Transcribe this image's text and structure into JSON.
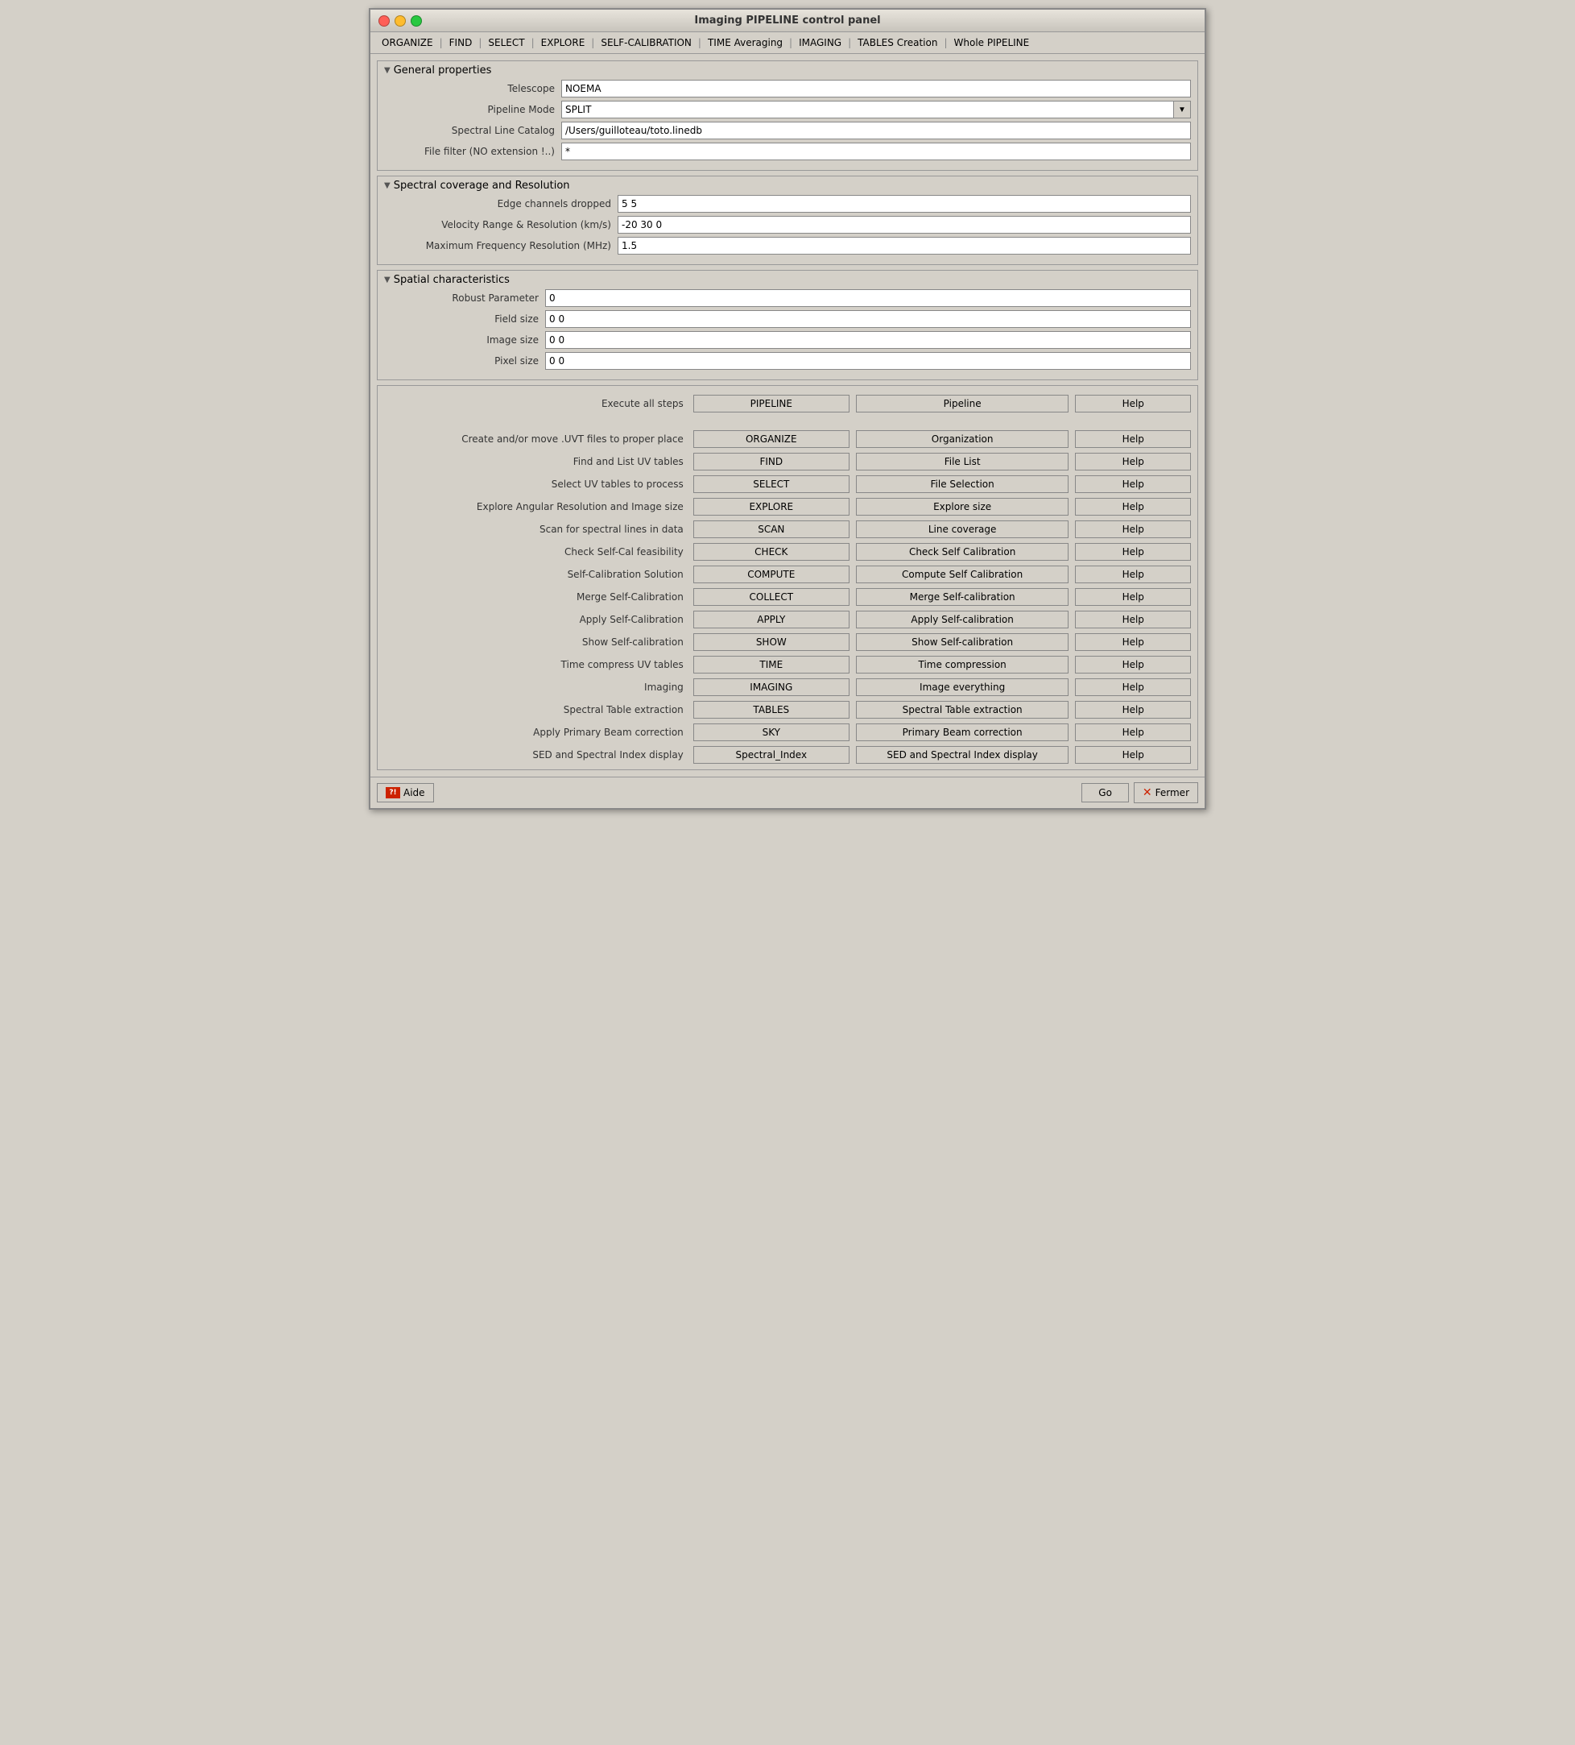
{
  "window": {
    "title": "Imaging PIPELINE control panel"
  },
  "menubar": {
    "items": [
      {
        "label": "ORGANIZE"
      },
      {
        "label": "FIND"
      },
      {
        "label": "SELECT"
      },
      {
        "label": "EXPLORE"
      },
      {
        "label": "SELF-CALIBRATION"
      },
      {
        "label": "TIME Averaging"
      },
      {
        "label": "IMAGING"
      },
      {
        "label": "TABLES Creation"
      },
      {
        "label": "Whole PIPELINE"
      }
    ]
  },
  "general": {
    "title": "General properties",
    "fields": {
      "telescope_label": "Telescope",
      "telescope_value": "NOEMA",
      "pipeline_mode_label": "Pipeline Mode",
      "pipeline_mode_value": "SPLIT",
      "spectral_catalog_label": "Spectral Line Catalog",
      "spectral_catalog_value": "/Users/guilloteau/toto.linedb",
      "file_filter_label": "File filter (NO extension !..)",
      "file_filter_value": "*"
    }
  },
  "spectral": {
    "title": "Spectral coverage and Resolution",
    "fields": {
      "edge_channels_label": "Edge channels dropped",
      "edge_channels_value": "5 5",
      "velocity_label": "Velocity Range & Resolution (km/s)",
      "velocity_value": "-20 30 0",
      "max_freq_label": "Maximum Frequency Resolution (MHz)",
      "max_freq_value": "1.5"
    }
  },
  "spatial": {
    "title": "Spatial characteristics",
    "fields": {
      "robust_label": "Robust Parameter",
      "robust_value": "0",
      "field_size_label": "Field  size",
      "field_size_value": "0 0",
      "image_size_label": "Image size",
      "image_size_value": "0 0",
      "pixel_size_label": "Pixel size",
      "pixel_size_value": "0 0"
    }
  },
  "actions": {
    "execute_all_label": "Execute all steps",
    "pipeline_btn": "PIPELINE",
    "pipeline_doc_btn": "Pipeline",
    "help_btn": "Help",
    "rows": [
      {
        "label": "Create and/or move .UVT files to proper place",
        "action": "ORGANIZE",
        "doc": "Organization",
        "help": "Help"
      },
      {
        "label": "Find and List UV tables",
        "action": "FIND",
        "doc": "File List",
        "help": "Help"
      },
      {
        "label": "Select UV tables to process",
        "action": "SELECT",
        "doc": "File Selection",
        "help": "Help"
      },
      {
        "label": "Explore Angular Resolution and Image size",
        "action": "EXPLORE",
        "doc": "Explore size",
        "help": "Help"
      },
      {
        "label": "Scan for spectral lines in data",
        "action": "SCAN",
        "doc": "Line coverage",
        "help": "Help"
      },
      {
        "label": "Check Self-Cal feasibility",
        "action": "CHECK",
        "doc": "Check Self Calibration",
        "help": "Help"
      },
      {
        "label": "Self-Calibration Solution",
        "action": "COMPUTE",
        "doc": "Compute Self Calibration",
        "help": "Help"
      },
      {
        "label": "Merge Self-Calibration",
        "action": "COLLECT",
        "doc": "Merge Self-calibration",
        "help": "Help"
      },
      {
        "label": "Apply Self-Calibration",
        "action": "APPLY",
        "doc": "Apply Self-calibration",
        "help": "Help"
      },
      {
        "label": "Show Self-calibration",
        "action": "SHOW",
        "doc": "Show Self-calibration",
        "help": "Help"
      },
      {
        "label": "Time compress UV tables",
        "action": "TIME",
        "doc": "Time compression",
        "help": "Help"
      },
      {
        "label": "Imaging",
        "action": "IMAGING",
        "doc": "Image everything",
        "help": "Help"
      },
      {
        "label": "Spectral Table extraction",
        "action": "TABLES",
        "doc": "Spectral Table extraction",
        "help": "Help"
      },
      {
        "label": "Apply Primary Beam correction",
        "action": "SKY",
        "doc": "Primary Beam correction",
        "help": "Help"
      },
      {
        "label": "SED and Spectral Index display",
        "action": "Spectral_Index",
        "doc": "SED and Spectral Index display",
        "help": "Help"
      }
    ]
  },
  "bottom": {
    "aide_label": "Aide",
    "go_label": "Go",
    "fermer_label": "Fermer"
  }
}
